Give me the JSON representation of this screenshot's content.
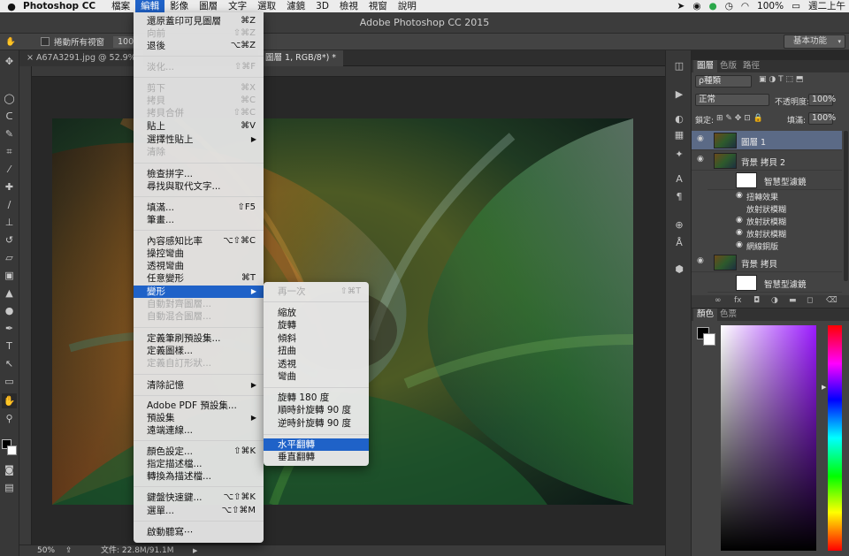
{
  "menubar": {
    "app_name": "Photoshop CC",
    "menus": [
      "檔案",
      "編輯",
      "影像",
      "圖層",
      "文字",
      "選取",
      "濾鏡",
      "3D",
      "檢視",
      "視窗",
      "說明"
    ],
    "battery": "100%",
    "clock": "週二上午"
  },
  "titlebar": {
    "title": "Adobe Photoshop CC 2015"
  },
  "options": {
    "scroll_all_label": "捲動所有視窗",
    "zoom_button": "100",
    "workspace": "基本功能"
  },
  "document": {
    "tab1": "A67A3291.jpg @ 52.9%",
    "tab2": "圖層 1, RGB/8*) *",
    "zoom": "50%",
    "file_info": "文件: 22.8M/91.1M"
  },
  "edit_menu": {
    "items": [
      {
        "label": "還原蓋印可見圖層",
        "shortcut": "⌘Z",
        "disabled": false
      },
      {
        "label": "向前",
        "shortcut": "⇧⌘Z",
        "disabled": true
      },
      {
        "label": "退後",
        "shortcut": "⌥⌘Z",
        "disabled": false
      },
      {
        "label": "淡化...",
        "shortcut": "⇧⌘F",
        "disabled": true
      },
      {
        "label": "剪下",
        "shortcut": "⌘X",
        "disabled": true
      },
      {
        "label": "拷貝",
        "shortcut": "⌘C",
        "disabled": true
      },
      {
        "label": "拷貝合併",
        "shortcut": "⇧⌘C",
        "disabled": true
      },
      {
        "label": "貼上",
        "shortcut": "⌘V",
        "disabled": false
      },
      {
        "label": "選擇性貼上",
        "shortcut": "",
        "disabled": false
      },
      {
        "label": "清除",
        "shortcut": "",
        "disabled": true
      },
      {
        "label": "檢查拼字...",
        "shortcut": "",
        "disabled": false
      },
      {
        "label": "尋找與取代文字...",
        "shortcut": "",
        "disabled": false
      },
      {
        "label": "填滿...",
        "shortcut": "⇧F5",
        "disabled": false
      },
      {
        "label": "筆畫...",
        "shortcut": "",
        "disabled": false
      },
      {
        "label": "內容感知比率",
        "shortcut": "⌥⇧⌘C",
        "disabled": false
      },
      {
        "label": "操控彎曲",
        "shortcut": "",
        "disabled": false
      },
      {
        "label": "透視彎曲",
        "shortcut": "",
        "disabled": false
      },
      {
        "label": "任意變形",
        "shortcut": "⌘T",
        "disabled": false
      },
      {
        "label": "變形",
        "shortcut": "",
        "disabled": false
      },
      {
        "label": "自動對齊圖層...",
        "shortcut": "",
        "disabled": true
      },
      {
        "label": "自動混合圖層...",
        "shortcut": "",
        "disabled": true
      },
      {
        "label": "定義筆刷預設集...",
        "shortcut": "",
        "disabled": false
      },
      {
        "label": "定義圖樣...",
        "shortcut": "",
        "disabled": false
      },
      {
        "label": "定義自訂形狀...",
        "shortcut": "",
        "disabled": true
      },
      {
        "label": "清除記憶",
        "shortcut": "",
        "disabled": false
      },
      {
        "label": "Adobe PDF 預設集...",
        "shortcut": "",
        "disabled": false
      },
      {
        "label": "預設集",
        "shortcut": "",
        "disabled": false
      },
      {
        "label": "遠端連線...",
        "shortcut": "",
        "disabled": false
      },
      {
        "label": "顏色設定...",
        "shortcut": "⇧⌘K",
        "disabled": false
      },
      {
        "label": "指定描述檔...",
        "shortcut": "",
        "disabled": false
      },
      {
        "label": "轉換為描述檔...",
        "shortcut": "",
        "disabled": false
      },
      {
        "label": "鍵盤快速鍵...",
        "shortcut": "⌥⇧⌘K",
        "disabled": false
      },
      {
        "label": "選單...",
        "shortcut": "⌥⇧⌘M",
        "disabled": false
      },
      {
        "label": "啟動聽寫⋯",
        "shortcut": "",
        "disabled": false
      }
    ]
  },
  "transform_submenu": {
    "items": [
      {
        "label": "再一次",
        "shortcut": "⇧⌘T",
        "disabled": true
      },
      {
        "label": "縮放",
        "shortcut": ""
      },
      {
        "label": "旋轉",
        "shortcut": ""
      },
      {
        "label": "傾斜",
        "shortcut": ""
      },
      {
        "label": "扭曲",
        "shortcut": ""
      },
      {
        "label": "透視",
        "shortcut": ""
      },
      {
        "label": "彎曲",
        "shortcut": ""
      },
      {
        "label": "旋轉 180 度",
        "shortcut": ""
      },
      {
        "label": "順時針旋轉 90 度",
        "shortcut": ""
      },
      {
        "label": "逆時針旋轉 90 度",
        "shortcut": ""
      },
      {
        "label": "水平翻轉",
        "shortcut": ""
      },
      {
        "label": "垂直翻轉",
        "shortcut": ""
      }
    ]
  },
  "layers_panel": {
    "tabs": [
      "圖層",
      "色版",
      "路徑"
    ],
    "kind_filter": "ρ種類",
    "blend_mode": "正常",
    "opacity_label": "不透明度:",
    "opacity": "100%",
    "lock_label": "鎖定:",
    "fill_label": "填滿:",
    "fill": "100%",
    "layers": [
      {
        "name": "圖層 1"
      },
      {
        "name": "背景 拷貝 2"
      },
      {
        "name": "智慧型濾鏡"
      },
      {
        "name": "扭轉效果"
      },
      {
        "name": "放射狀模糊"
      },
      {
        "name": "放射狀模糊"
      },
      {
        "name": "放射狀模糊"
      },
      {
        "name": "網線銅版"
      },
      {
        "name": "背景 拷貝"
      },
      {
        "name": "智慧型濾鏡"
      }
    ]
  },
  "color_panel": {
    "tabs": [
      "顏色",
      "色票"
    ]
  }
}
